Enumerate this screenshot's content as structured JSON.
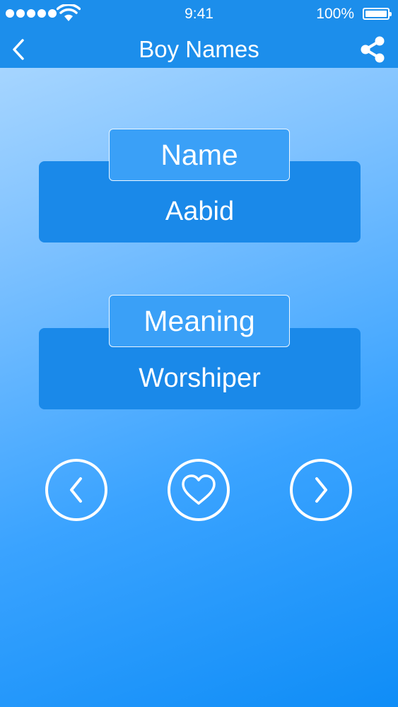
{
  "status_bar": {
    "time": "9:41",
    "battery": "100%"
  },
  "header": {
    "title": "Boy Names",
    "back_icon": "chevron-left-icon",
    "share_icon": "share-icon"
  },
  "name_card": {
    "label": "Name",
    "value": "Aabid"
  },
  "meaning_card": {
    "label": "Meaning",
    "value": "Worshiper"
  },
  "controls": {
    "previous_icon": "chevron-left-icon",
    "favorite_icon": "heart-icon",
    "next_icon": "chevron-right-icon"
  },
  "colors": {
    "header": "#1c8eeb",
    "card": "#1a89e9",
    "tab": "#3aa0f7",
    "gradient_top": "#b4dcff",
    "gradient_bottom": "#0f8df7"
  }
}
